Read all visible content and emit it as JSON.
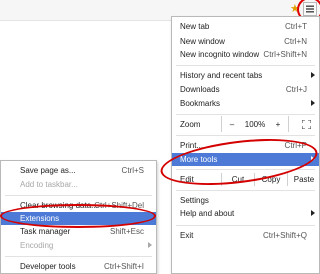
{
  "toolbar": {
    "star_icon": "star-icon",
    "menu_icon": "hamburger-menu-icon"
  },
  "main_menu": {
    "new_tab": {
      "label": "New tab",
      "shortcut": "Ctrl+T"
    },
    "new_window": {
      "label": "New window",
      "shortcut": "Ctrl+N"
    },
    "new_incognito": {
      "label": "New incognito window",
      "shortcut": "Ctrl+Shift+N"
    },
    "history": {
      "label": "History and recent tabs"
    },
    "downloads": {
      "label": "Downloads",
      "shortcut": "Ctrl+J"
    },
    "bookmarks": {
      "label": "Bookmarks"
    },
    "zoom": {
      "label": "Zoom",
      "minus": "–",
      "value": "100%",
      "plus": "+"
    },
    "print": {
      "label": "Print...",
      "shortcut": "Ctrl+P"
    },
    "more_tools": {
      "label": "More tools"
    },
    "edit": {
      "label": "Edit",
      "cut": "Cut",
      "copy": "Copy",
      "paste": "Paste"
    },
    "settings": {
      "label": "Settings"
    },
    "help": {
      "label": "Help and about"
    },
    "exit": {
      "label": "Exit",
      "shortcut": "Ctrl+Shift+Q"
    }
  },
  "sub_menu": {
    "save_page": {
      "label": "Save page as...",
      "shortcut": "Ctrl+S"
    },
    "add_taskbar": {
      "label": "Add to taskbar..."
    },
    "clear_data": {
      "label": "Clear browsing data...",
      "shortcut": "Ctrl+Shift+Del"
    },
    "extensions": {
      "label": "Extensions"
    },
    "task_manager": {
      "label": "Task manager",
      "shortcut": "Shift+Esc"
    },
    "encoding": {
      "label": "Encoding"
    },
    "dev_tools": {
      "label": "Developer tools",
      "shortcut": "Ctrl+Shift+I"
    }
  },
  "colors": {
    "highlight": "#4c7ad6",
    "annotation": "#d40000"
  }
}
